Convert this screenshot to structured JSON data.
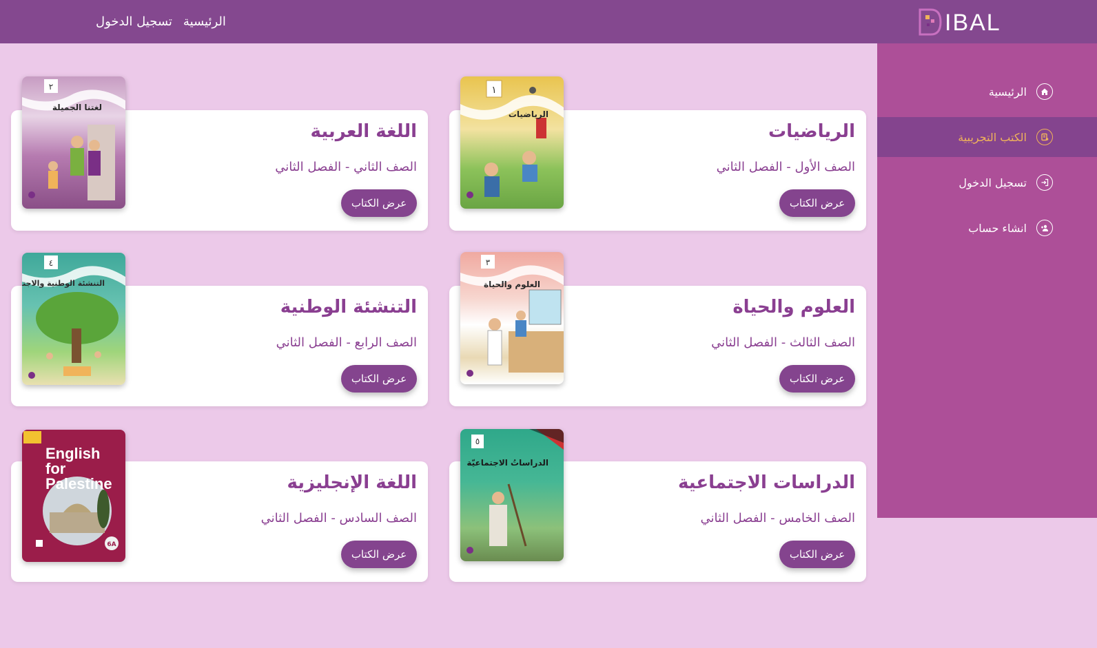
{
  "header": {
    "logo_text": "IBAL",
    "nav": [
      {
        "label": "الرئيسية"
      },
      {
        "label": "تسجيل الدخول"
      }
    ]
  },
  "sidebar": {
    "items": [
      {
        "label": "الرئيسية",
        "icon": "home-icon"
      },
      {
        "label": "الكتب التجريبية",
        "icon": "book-icon",
        "active": true
      },
      {
        "label": "تسجيل الدخول",
        "icon": "login-icon"
      },
      {
        "label": "انشاء حساب",
        "icon": "add-user-icon"
      }
    ]
  },
  "books": [
    {
      "title": "الرياضيات",
      "grade": "الصف الأول - الفصل الثاني",
      "button": "عرض الكتاب",
      "cover_text": "الرياضيات",
      "cover_color": "#e9c44f",
      "cover_number": "١"
    },
    {
      "title": "اللغة العربية",
      "grade": "الصف الثاني - الفصل الثاني",
      "button": "عرض الكتاب",
      "cover_text": "لغتنا الجميلة",
      "cover_color": "#b87bb0",
      "cover_number": "٢"
    },
    {
      "title": "العلوم والحياة",
      "grade": "الصف الثالث - الفصل الثاني",
      "button": "عرض الكتاب",
      "cover_text": "العلوم والحياة",
      "cover_color": "#f0a9a0",
      "cover_number": "٣"
    },
    {
      "title": "التنشئة الوطنية",
      "grade": "الصف الرابع - الفصل الثاني",
      "button": "عرض الكتاب",
      "cover_text": "التنشئة الوطنية والاجتماعية",
      "cover_color": "#3fa89a",
      "cover_number": "٤"
    },
    {
      "title": "الدراسات الاجتماعية",
      "grade": "الصف الخامس - الفصل الثاني",
      "button": "عرض الكتاب",
      "cover_text": "الدراساتُ الاجتماعيّة",
      "cover_color": "#3fae92",
      "cover_number": "٥"
    },
    {
      "title": "اللغة الإنجليزية",
      "grade": "الصف السادس - الفصل الثاني",
      "button": "عرض الكتاب",
      "cover_text": "English for Palestine",
      "cover_color": "#9b1d4a",
      "cover_number": "6A"
    }
  ],
  "colors": {
    "background": "#ecc9e9",
    "header": "#84488f",
    "sidebar": "#ad4f98",
    "sidebar_active": "#84448e",
    "accent_active_text": "#f0b35a",
    "title_text": "#8a3f91",
    "button": "#84448e"
  }
}
